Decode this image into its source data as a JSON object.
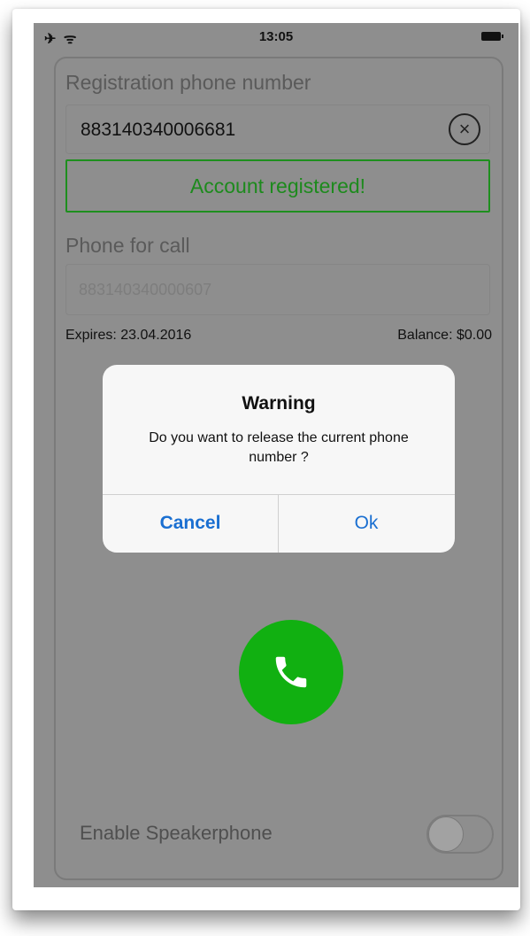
{
  "status_bar": {
    "left_icons": "✈ ᯤ",
    "time": "13:05",
    "battery_icon": "battery-icon"
  },
  "registration": {
    "label": "Registration phone number",
    "phone_value": "883140340006681",
    "clear_icon": "close-circle-icon",
    "status_text": "Account registered!"
  },
  "call": {
    "label": "Phone for call",
    "placeholder": "883140340000607",
    "expires": "Expires: 23.04.2016",
    "balance": "Balance: $0.00"
  },
  "alert": {
    "title": "Warning",
    "message": "Do you want to release the current phone number ?",
    "cancel_label": "Cancel",
    "ok_label": "Ok"
  },
  "call_button_icon": "phone-icon",
  "speaker": {
    "label": "Enable Speakerphone",
    "enabled": false
  },
  "colors": {
    "accent_green": "#11b011",
    "registered_text": "#1d8a1d",
    "alert_button": "#1a6fd1",
    "overlay_gray": "#8e8e8e"
  }
}
